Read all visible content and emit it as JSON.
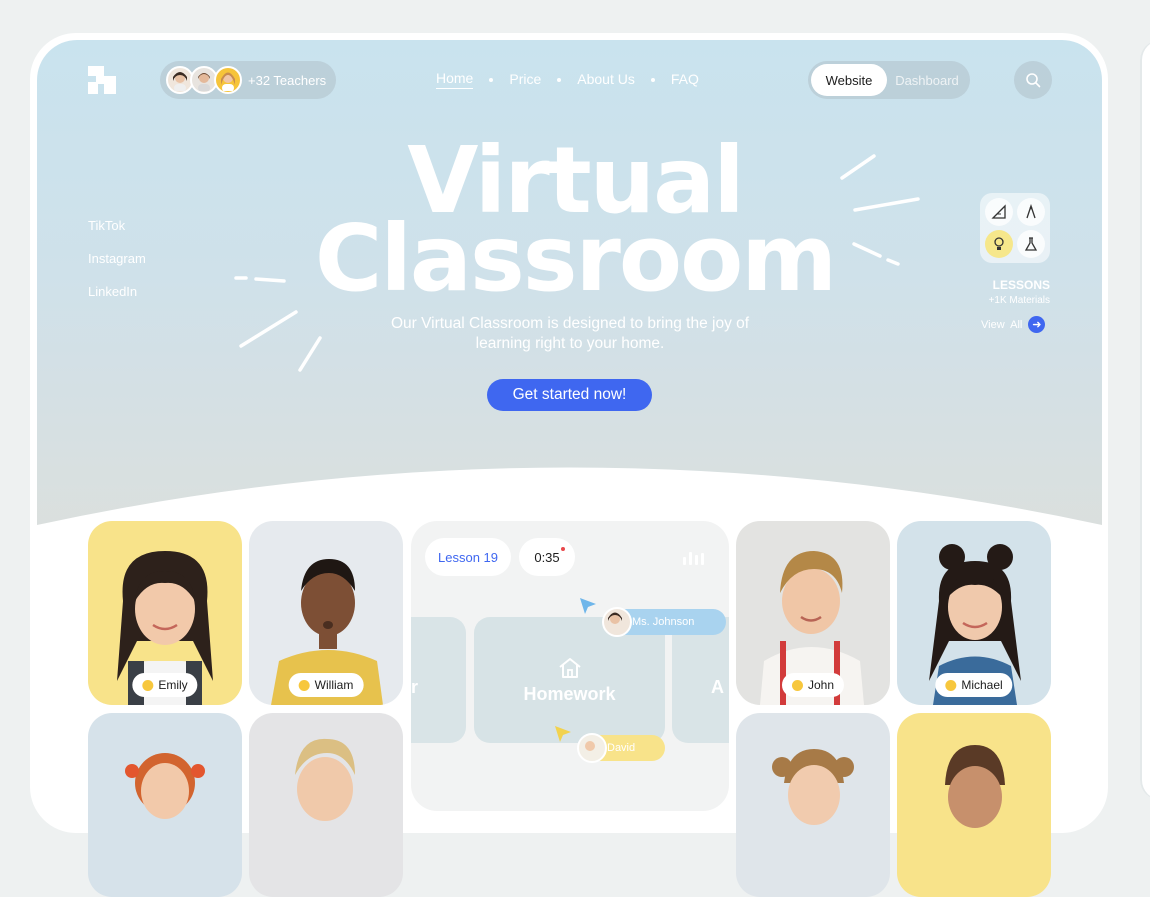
{
  "header": {
    "teachers_label": "+32 Teachers",
    "nav": [
      "Home",
      "Price",
      "About Us",
      "FAQ"
    ],
    "toggle": {
      "active": "Website",
      "inactive": "Dashboard"
    }
  },
  "social": [
    "TikTok",
    "Instagram",
    "LinkedIn"
  ],
  "hero": {
    "title_line1": "Virtual",
    "title_line2": "Classroom",
    "subtitle": "Our Virtual Classroom is designed to bring the joy of learning right to your home.",
    "cta": "Get started now!"
  },
  "lessons": {
    "label": "LESSONS",
    "sub": "+1K Materials",
    "view_all": "View  All"
  },
  "students": [
    "Emily",
    "William",
    "John",
    "Michael"
  ],
  "lesson_panel": {
    "lesson": "Lesson 19",
    "time": "0:35",
    "slide_title": "Homework",
    "teacher": "Ms. Johnson",
    "student": "David",
    "edge_left_letter": "r",
    "edge_right_letter": "A"
  },
  "colors": {
    "accent": "#3f67f0",
    "yellow_card": "#f8e38a",
    "grey_card": "#e6eaee",
    "blue_card": "#d3e2ea"
  }
}
